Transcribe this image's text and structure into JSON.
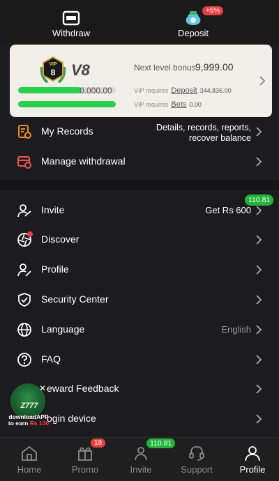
{
  "colors": {
    "accent_green": "#2ad04d",
    "badge_red": "#e84040",
    "badge_green": "#23b33a",
    "icon_orange": "#f08a24",
    "icon_red": "#e8564f",
    "background": "#1c1c1e",
    "card": "#f2efe9"
  },
  "header": {
    "withdraw_label": "Withdraw",
    "withdraw_icon": "ticket-icon",
    "deposit_label": "Deposit",
    "deposit_icon": "money-bag-icon",
    "deposit_badge": "+5%"
  },
  "vip": {
    "level": "V8",
    "badge_text": "VIP",
    "badge_number": "8",
    "next_label": "Next level bonus",
    "next_value": "9,999.00",
    "bar1_text": "0.000.00",
    "bar1_progress": 0.65,
    "bar2_progress": 1.0,
    "req_prefix": "VIP requires",
    "deposit_link": "Deposit",
    "deposit_amount": "344,836.00",
    "bets_link": "Bets",
    "bets_amount": "0.00"
  },
  "menu_top": [
    {
      "label": "My Records",
      "icon": "records-icon",
      "right": "Details, records, reports,",
      "right2": "recover balance"
    },
    {
      "label": "Manage withdrawal",
      "icon": "manage-withdrawal-icon"
    }
  ],
  "menu": {
    "invite": {
      "label": "Invite",
      "right": "Get Rs 600",
      "badge": "110.81"
    },
    "discover": {
      "label": "Discover"
    },
    "profile": {
      "label": "Profile"
    },
    "security": {
      "label": "Security Center"
    },
    "language": {
      "label": "Language",
      "right": "English"
    },
    "faq": {
      "label": "FAQ"
    },
    "feedback": {
      "label": "Reward Feedback",
      "visible_label": "eward Feedback"
    },
    "login": {
      "label": "Login device",
      "visible_label": "ogin device"
    }
  },
  "promo": {
    "logo_text": "Z777",
    "caption1": "downloadAPP",
    "caption2": "to earn",
    "caption_amount": "Rs 100",
    "close": "✕"
  },
  "nav": {
    "home": "Home",
    "promo": "Promo",
    "promo_badge": "19",
    "invite": "Invite",
    "invite_badge": "110.81",
    "support": "Support",
    "profile": "Profile"
  }
}
